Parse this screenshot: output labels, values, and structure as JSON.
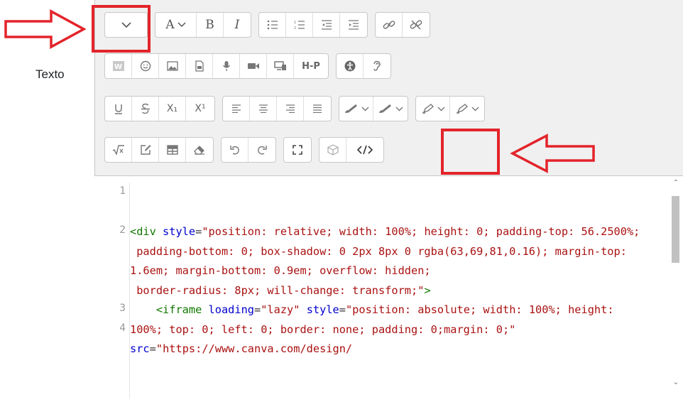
{
  "label": "Texto",
  "toolbar": {
    "row1": {
      "collapse": "chevron-down-icon",
      "font_letter": "A",
      "bold": "B",
      "italic": "I"
    },
    "row3": {
      "subscript": "X₁",
      "superscript": "X¹"
    },
    "row2": {
      "h5p": "H-P"
    }
  },
  "editor": {
    "line_numbers": [
      "1",
      "2",
      "3",
      "4"
    ],
    "lines": [
      {
        "tag": "<div",
        "attr": " style",
        "eq": "=",
        "str": "\"position: relative; width: 100%; height: 0; padding-top: 56.2500%;"
      },
      {
        "str": " padding-bottom: 0; box-shadow: 0 2px 8px 0 rgba(63,69,81,0.16); margin-top: 1.6em; margin-bottom: 0.9em; overflow: hidden;"
      },
      {
        "str": " border-radius: 8px; will-change: transform;\"",
        "tag": ">"
      },
      {
        "indent": "    ",
        "tag": "<iframe",
        "attr1": " loading",
        "str1": "\"lazy\"",
        "attr2": " style",
        "str2": "\"position: absolute; width: 100%; height: 100%; top: 0; left: 0; border: none; padding: 0;margin: 0;\"",
        "attr3": " src",
        "str3": "\"https://www.canva.com/design/"
      }
    ]
  },
  "colors": {
    "annotation": "#e3242b",
    "tag": "#117700",
    "attr": "#0000cc",
    "string": "#a31515"
  }
}
